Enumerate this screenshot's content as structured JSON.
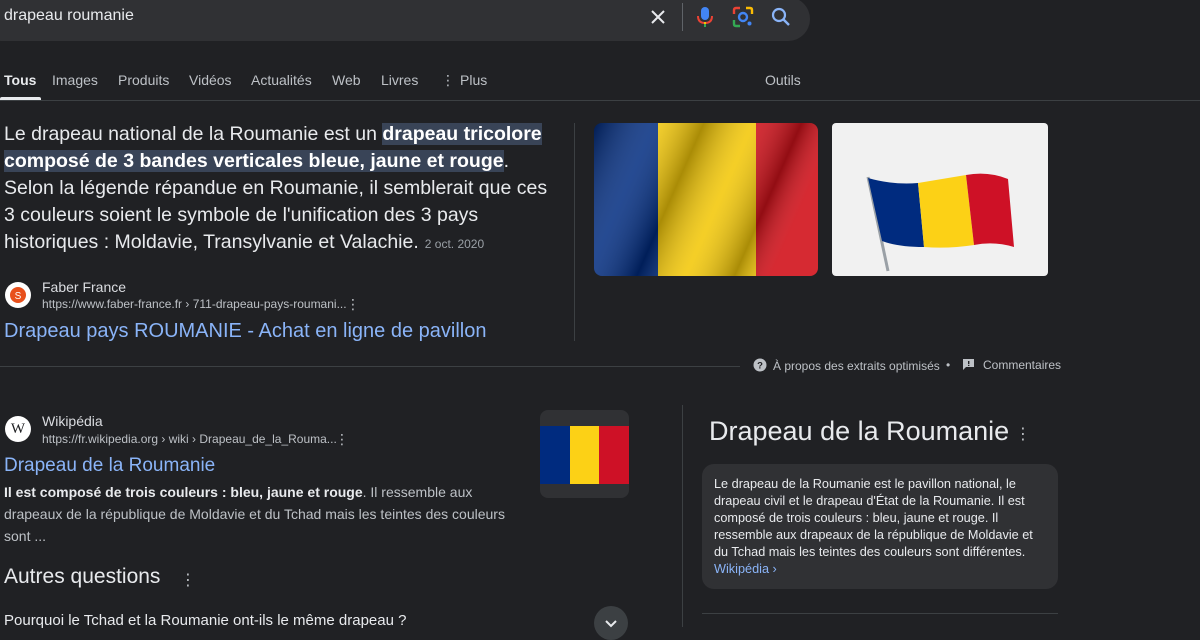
{
  "search": {
    "query": "drapeau roumanie"
  },
  "tabs": [
    {
      "label": "Tous"
    },
    {
      "label": "Images"
    },
    {
      "label": "Produits"
    },
    {
      "label": "Vidéos"
    },
    {
      "label": "Actualités"
    },
    {
      "label": "Web"
    },
    {
      "label": "Livres"
    },
    {
      "label": "Plus"
    }
  ],
  "tools_label": "Outils",
  "featured": {
    "text_before": "Le drapeau national de la Roumanie est un ",
    "highlight": "drapeau tricolore composé de 3 bandes verticales bleue, jaune et rouge",
    "text_after": ". Selon la légende répandue en Roumanie, il semblerait que ces 3 couleurs soient le symbole de l'unification des 3 pays historiques : Moldavie, Transylvanie et Valachie.",
    "date": "2 oct. 2020",
    "source_name": "Faber France",
    "source_url": "https://www.faber-france.fr › 711-drapeau-pays-roumani...",
    "link_title": "Drapeau pays ROUMANIE - Achat en ligne de pavillon"
  },
  "feedback": {
    "about_label": "À propos des extraits optimisés",
    "separator": "•",
    "comments_label": "Commentaires"
  },
  "result_wiki": {
    "source_name": "Wikipédia",
    "source_url": "https://fr.wikipedia.org › wiki › Drapeau_de_la_Rouma...",
    "title": "Drapeau de la Roumanie",
    "desc_bold": "Il est composé de trois couleurs : bleu, jaune et rouge",
    "desc_rest": ". Il ressemble aux drapeaux de la république de Moldavie et du Tchad mais les teintes des couleurs sont ..."
  },
  "knowledge_panel": {
    "title": "Drapeau de la Roumanie",
    "description": "Le drapeau de la Roumanie est le pavillon national, le drapeau civil et le drapeau d'État de la Roumanie. Il est composé de trois couleurs : bleu, jaune et rouge. Il ressemble aux drapeaux de la république de Moldavie et du Tchad mais les teintes des couleurs sont différentes.",
    "source_link": "Wikipédia ›"
  },
  "faq": {
    "title": "Autres questions",
    "question_1": "Pourquoi le Tchad et la Roumanie ont-ils le même drapeau ?"
  },
  "colors": {
    "background": "#202124",
    "link": "#8ab4f8",
    "flag_blue": "#002b7f",
    "flag_yellow": "#fcd116",
    "flag_red": "#ce1126"
  }
}
